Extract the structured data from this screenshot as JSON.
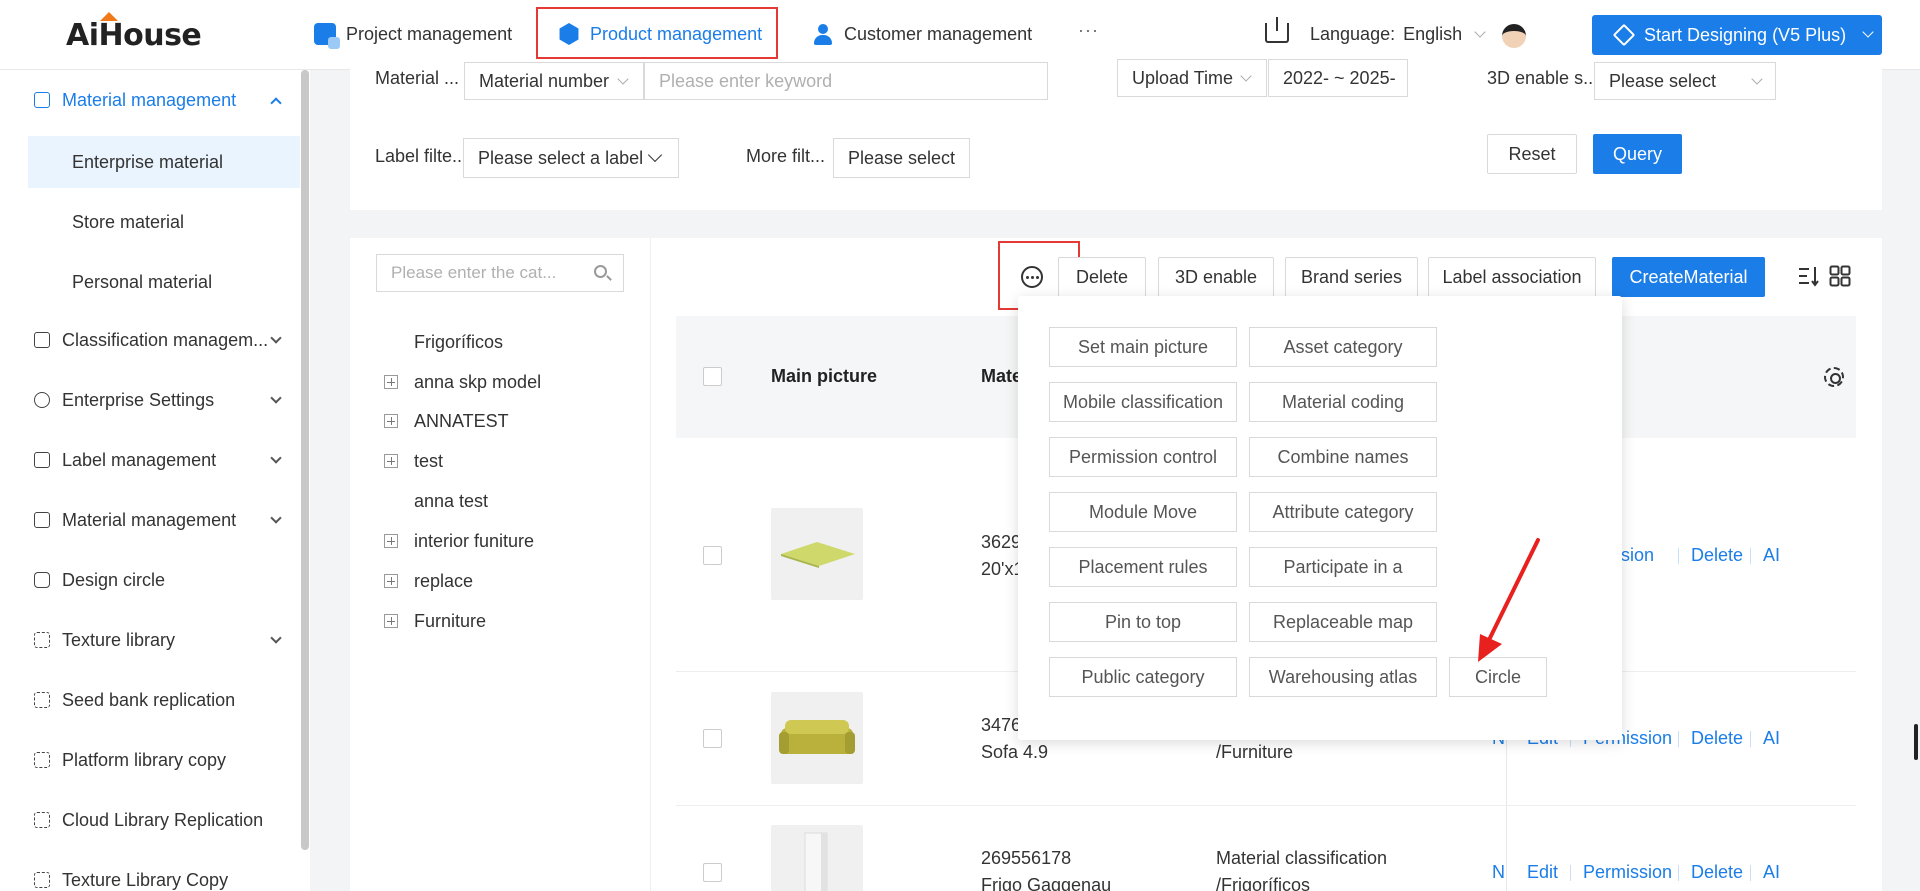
{
  "app": {
    "logo": "AiHouse"
  },
  "topnav": {
    "items": [
      {
        "label": "Project management"
      },
      {
        "label": "Product management"
      },
      {
        "label": "Customer management"
      }
    ],
    "more": "···",
    "language_label": "Language:",
    "language_value": "English",
    "start_button": "Start Designing (V5 Plus)"
  },
  "sidebar": {
    "items": [
      {
        "label": "Material management"
      },
      {
        "label": "Classification managem..."
      },
      {
        "label": "Enterprise Settings"
      },
      {
        "label": "Label management"
      },
      {
        "label": "Material management"
      },
      {
        "label": "Design circle"
      },
      {
        "label": "Texture library"
      },
      {
        "label": "Seed bank replication"
      },
      {
        "label": "Platform library copy"
      },
      {
        "label": "Cloud Library Replication"
      },
      {
        "label": "Texture Library Copy"
      }
    ],
    "subitems": [
      {
        "label": "Enterprise material"
      },
      {
        "label": "Store material"
      },
      {
        "label": "Personal material"
      }
    ]
  },
  "filters": {
    "material_label": "Material ...",
    "material_select": "Material number",
    "keyword_placeholder": "Please enter keyword",
    "upload_select": "Upload Time",
    "date_range": "2022- ~ 2025-",
    "enable3d_label": "3D enable s...",
    "enable3d_select": "Please select",
    "label_filter_label": "Label filte...",
    "label_filter_select": "Please select a label",
    "more_filter_label": "More filt...",
    "more_filter_select": "Please select",
    "reset": "Reset",
    "query": "Query"
  },
  "tree": {
    "search_placeholder": "Please enter the cat...",
    "nodes": [
      {
        "label": "Frigoríficos",
        "expandable": false
      },
      {
        "label": "anna skp model",
        "expandable": true
      },
      {
        "label": "ANNATEST",
        "expandable": true
      },
      {
        "label": "test",
        "expandable": true
      },
      {
        "label": "anna test",
        "expandable": false
      },
      {
        "label": "interior funiture",
        "expandable": true
      },
      {
        "label": "replace",
        "expandable": true
      },
      {
        "label": "Furniture",
        "expandable": true
      }
    ]
  },
  "toolbar": {
    "delete": "Delete",
    "enable3d": "3D enable",
    "brand_series": "Brand series",
    "label_association": "Label association",
    "create": "CreateMaterial"
  },
  "table": {
    "headers": {
      "main_picture": "Main picture",
      "material": "Mate"
    },
    "rows": [
      {
        "line1": "3629",
        "line2": "20'x1",
        "class1": "",
        "class2": "",
        "ops": [
          "Permission",
          "Delete",
          "AI"
        ],
        "ops_partial": "rission"
      },
      {
        "line1": "3476",
        "line2": "Sofa 4.9",
        "class1": "",
        "class2": "/Furniture",
        "ops": [
          "N",
          "Edit",
          "Permission",
          "Delete",
          "AI"
        ]
      },
      {
        "line1": "269556178",
        "line2": "Frigo Gaggenau",
        "class1": "Material classification",
        "class2": "/Frigoríficos",
        "ops": [
          "N",
          "Edit",
          "Permission",
          "Delete",
          "AI"
        ]
      }
    ]
  },
  "popover": {
    "buttons": [
      "Set main picture",
      "Asset category",
      "Mobile classification",
      "Material coding",
      "Permission control",
      "Combine names",
      "Module Move",
      "Attribute category",
      "Placement rules",
      "Participate in a",
      "Pin to top",
      "Replaceable map",
      "Public category",
      "Warehousing atlas",
      "Circle"
    ]
  },
  "colors": {
    "accent": "#1b7de8",
    "highlight_box": "#e53935",
    "logo_roof": "#f07a1a"
  }
}
